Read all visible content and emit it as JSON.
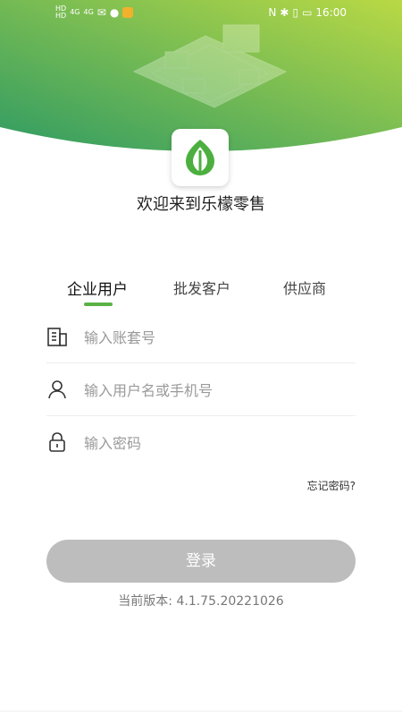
{
  "status_bar": {
    "left_mini_1": "HD",
    "left_mini_2": "HD",
    "signal_1": "4G",
    "signal_2": "4G",
    "time": "16:00",
    "colors": {
      "badge": "#f2b12d"
    }
  },
  "header": {
    "colors": {
      "gradient_start": "#2f9b63",
      "gradient_end": "#b9d945"
    }
  },
  "logo": {
    "name": "leaf-logo-icon"
  },
  "welcome": "欢迎来到乐檬零售",
  "tabs": [
    {
      "label": "企业用户",
      "active": true
    },
    {
      "label": "批发客户",
      "active": false
    },
    {
      "label": "供应商",
      "active": false
    }
  ],
  "form": {
    "account_set": {
      "placeholder": "输入账套号",
      "value": ""
    },
    "username": {
      "placeholder": "输入用户名或手机号",
      "value": ""
    },
    "password": {
      "placeholder": "输入密码",
      "value": ""
    }
  },
  "forgot_password": "忘记密码?",
  "login_button": "登录",
  "version": "当前版本: 4.1.75.20221026",
  "colors": {
    "accent_green": "#5bb145",
    "button_disabled": "#bdbdbd"
  }
}
